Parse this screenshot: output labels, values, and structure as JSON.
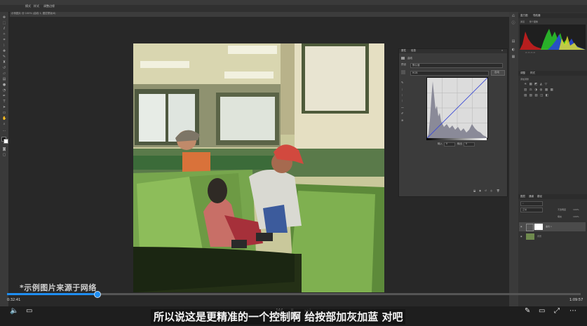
{
  "app": {
    "options_bar": [
      "模式",
      "样式",
      "调整边缘"
    ],
    "document_tab": "示例图片 @ 100% (曲线 1, 图层蒙版/8)"
  },
  "curves_dialog": {
    "tabs": [
      "属性",
      "信息"
    ],
    "title": "曲线",
    "preset_label": "预设",
    "preset_value": "默认值",
    "channel_value": "RGB",
    "auto_button": "自动",
    "input_label": "输入",
    "input_value": "0",
    "output_label": "输出",
    "output_value": "0"
  },
  "panels": {
    "navigator_tabs": [
      "直方图",
      "导航器"
    ],
    "histogram_channel": "通道",
    "histogram_source": "整个图像",
    "adjust_tabs": [
      "调整",
      "样式"
    ],
    "adjust_hint": "添加调整",
    "layers_tabs": [
      "图层",
      "通道",
      "路径"
    ],
    "blend_mode": "正常",
    "opacity_label": "不透明度",
    "opacity": "100%",
    "fill_label": "填充",
    "fill": "100%",
    "layers": [
      {
        "name": "曲线 1"
      },
      {
        "name": "背景"
      }
    ]
  },
  "watermark": "*示例图片来源于网络",
  "video": {
    "current_time": "0:32:41",
    "duration": "1:09:57",
    "progress": 0.157,
    "subtitle": "所以说这是更精准的一个控制啊 给按部加灰加蓝 对吧"
  },
  "icons": {
    "volume": "volume-icon",
    "danmaku": "comment-icon",
    "pen": "pen-icon",
    "screen": "screen-icon",
    "fullscreen": "fullscreen-icon",
    "more": "more-icon"
  }
}
